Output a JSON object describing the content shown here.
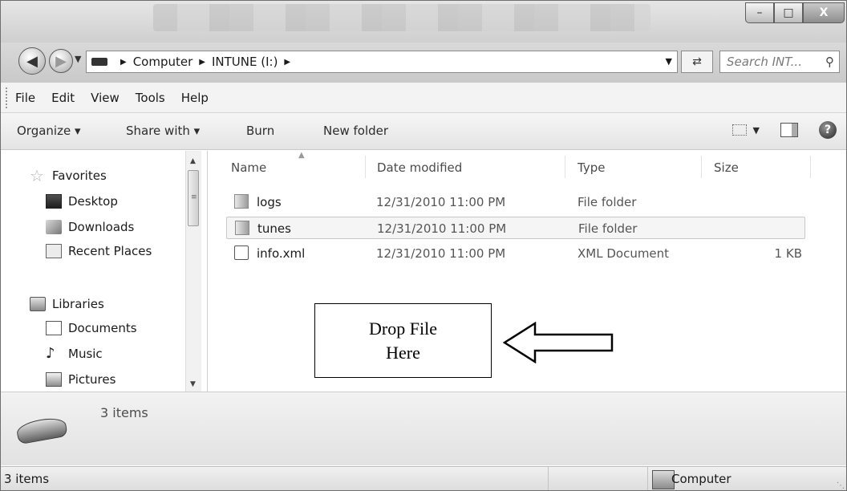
{
  "window": {
    "controls": {
      "minimize": "–",
      "maximize": "□",
      "close": "X"
    }
  },
  "address": {
    "breadcrumbs": [
      "Computer",
      "INTUNE (I:)"
    ],
    "search_placeholder": "Search INT..."
  },
  "menu": [
    "File",
    "Edit",
    "View",
    "Tools",
    "Help"
  ],
  "toolbar": {
    "organize": "Organize ▾",
    "share_with": "Share with ▾",
    "burn": "Burn",
    "new_folder": "New folder"
  },
  "nav": {
    "favorites": "Favorites",
    "desktop": "Desktop",
    "downloads": "Downloads",
    "recent_places": "Recent Places",
    "libraries": "Libraries",
    "documents": "Documents",
    "music": "Music",
    "pictures": "Pictures"
  },
  "columns": {
    "name": "Name",
    "date": "Date modified",
    "type": "Type",
    "size": "Size"
  },
  "files": [
    {
      "name": "logs",
      "date": "12/31/2010 11:00 PM",
      "type": "File folder",
      "size": "",
      "icon": "folder-icon"
    },
    {
      "name": "tunes",
      "date": "12/31/2010 11:00 PM",
      "type": "File folder",
      "size": "",
      "icon": "folder-icon"
    },
    {
      "name": "info.xml",
      "date": "12/31/2010 11:00 PM",
      "type": "XML Document",
      "size": "1 KB",
      "icon": "xml-file-icon"
    }
  ],
  "annotation": {
    "line1": "Drop File",
    "line2": "Here"
  },
  "details": {
    "count": "3 items"
  },
  "status": {
    "count": "3 items",
    "location": "Computer"
  }
}
